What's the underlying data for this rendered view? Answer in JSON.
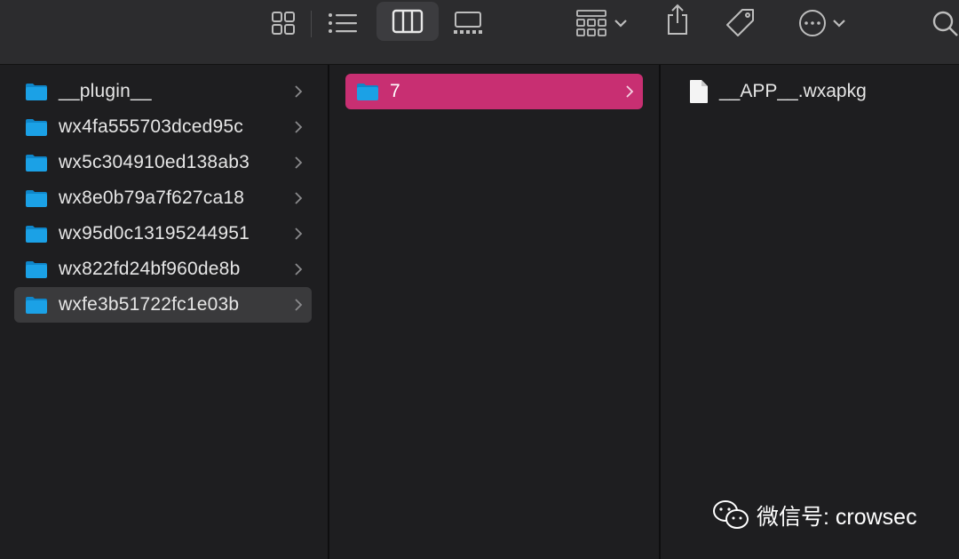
{
  "toolbar": {
    "icons": [
      "icon-view-icon",
      "list-view-icon",
      "column-view-icon",
      "gallery-view-icon",
      "group-icon",
      "share-icon",
      "tag-icon",
      "more-icon",
      "search-icon"
    ],
    "active_view": "column-view"
  },
  "column1": {
    "items": [
      {
        "label": "__plugin__"
      },
      {
        "label": "wx4fa555703dced95c"
      },
      {
        "label": "wx5c304910ed138ab3"
      },
      {
        "label": "wx8e0b79a7f627ca18"
      },
      {
        "label": "wx95d0c13195244951"
      },
      {
        "label": "wx822fd24bf960de8b"
      },
      {
        "label": "wxfe3b51722fc1e03b"
      }
    ],
    "selected_index": 6
  },
  "column2": {
    "items": [
      {
        "label": "7"
      }
    ],
    "selected_index": 0
  },
  "column3": {
    "items": [
      {
        "label": "__APP__.wxapkg"
      }
    ]
  },
  "watermark": {
    "text": "微信号: crowsec"
  },
  "colors": {
    "selection_accent": "#c82f72",
    "folder_blue": "#1ba1e6",
    "window_bg": "#1e1e20",
    "toolbar_bg": "#2c2c2e"
  }
}
